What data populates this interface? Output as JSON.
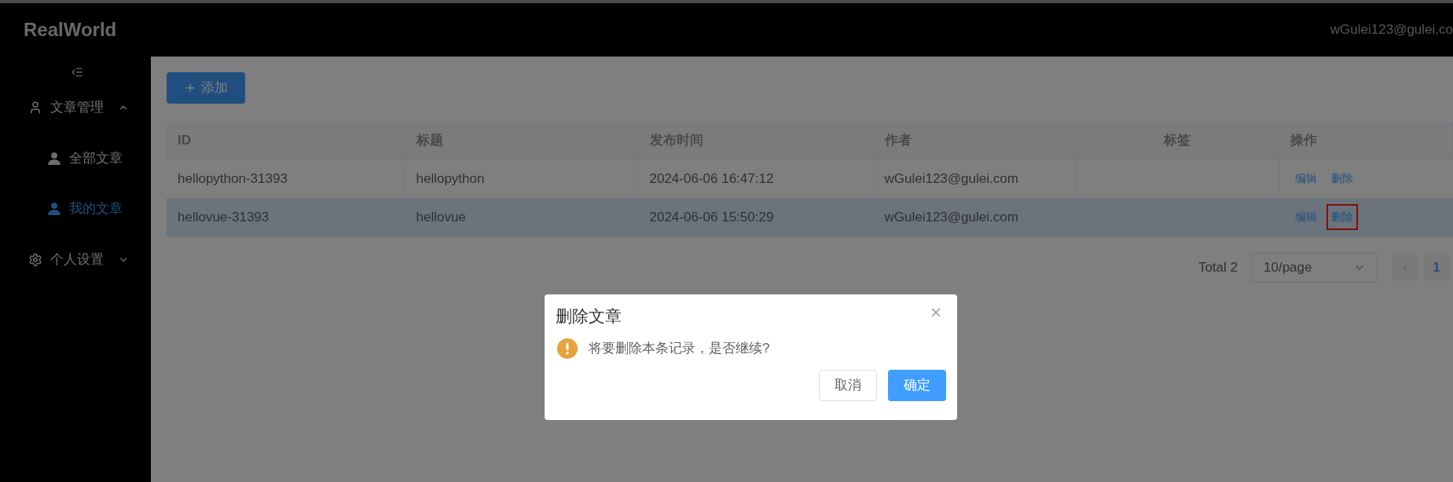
{
  "header": {
    "logo": "RealWorld",
    "user": "wGulei123@gulei.co"
  },
  "sidebar": {
    "items": [
      {
        "label": "文章管理",
        "expanded": true,
        "children": [
          {
            "label": "全部文章",
            "selected": false
          },
          {
            "label": "我的文章",
            "selected": true
          }
        ]
      },
      {
        "label": "个人设置",
        "expanded": false
      }
    ]
  },
  "toolbar": {
    "add_button": "添加"
  },
  "table": {
    "columns": [
      "ID",
      "标题",
      "发布时间",
      "作者",
      "标签",
      "操作"
    ],
    "rows": [
      {
        "hovered": false,
        "cells": [
          "hellopython-31393",
          "hellopython",
          "2024-06-06 16:47:12",
          "wGulei123@gulei.com"
        ],
        "actions": [
          {
            "label": "编辑",
            "highlighted": false
          },
          {
            "label": "删除",
            "highlighted": false
          }
        ]
      },
      {
        "hovered": true,
        "cells": [
          "hellovue-31393",
          "hellovue",
          "2024-06-06 15:50:29",
          "wGulei123@gulei.com"
        ],
        "actions": [
          {
            "label": "编辑",
            "highlighted": false
          },
          {
            "label": "删除",
            "highlighted": true
          }
        ]
      }
    ]
  },
  "pagination": {
    "total": "Total 2",
    "page_size": "10/page",
    "pages": [
      {
        "label": "1",
        "selected": true
      }
    ]
  },
  "dialog": {
    "title": "删除文章",
    "message": "将要删除本条记录，是否继续?",
    "buttons": [
      {
        "label": "取消",
        "kind": "default"
      },
      {
        "label": "确定",
        "kind": "primary"
      }
    ]
  }
}
